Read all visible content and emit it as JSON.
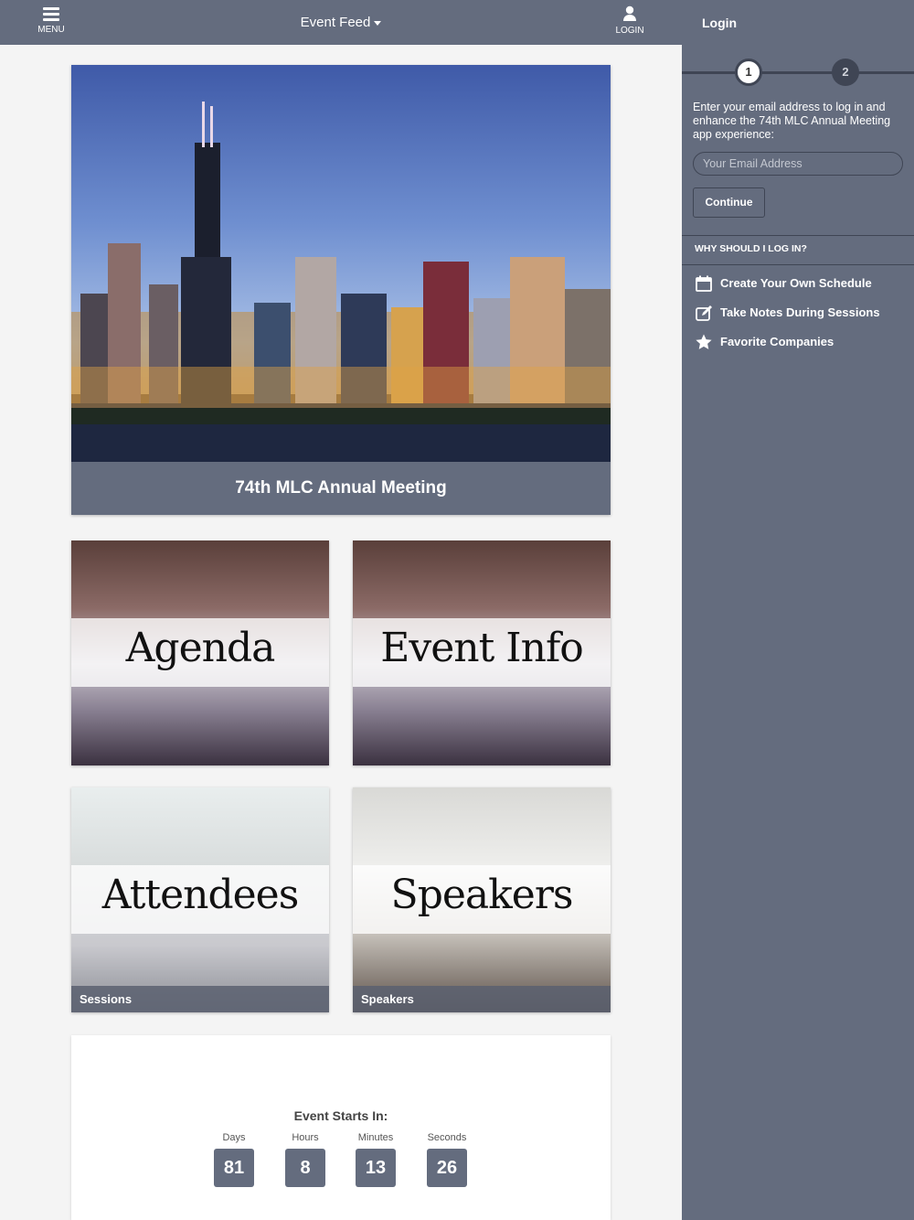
{
  "topbar": {
    "menu_label": "MENU",
    "title": "Event Feed",
    "login_label": "LOGIN"
  },
  "hero": {
    "caption": "74th MLC Annual Meeting"
  },
  "tiles": {
    "agenda": {
      "title": "Agenda",
      "footer": ""
    },
    "event_info": {
      "title": "Event Info",
      "footer": ""
    },
    "attendees": {
      "title": "Attendees",
      "footer": "Sessions"
    },
    "speakers": {
      "title": "Speakers",
      "footer": "Speakers"
    }
  },
  "countdown": {
    "heading": "Event Starts In:",
    "units": [
      {
        "label": "Days",
        "value": "81"
      },
      {
        "label": "Hours",
        "value": "8"
      },
      {
        "label": "Minutes",
        "value": "13"
      },
      {
        "label": "Seconds",
        "value": "26"
      }
    ]
  },
  "login_panel": {
    "title": "Login",
    "steps": [
      "1",
      "2"
    ],
    "intro": "Enter your email address to log in and enhance the 74th MLC Annual Meeting app experience:",
    "email_placeholder": "Your Email Address",
    "continue_label": "Continue",
    "why_heading": "WHY SHOULD I LOG IN?",
    "features": [
      {
        "icon": "calendar-icon",
        "label": "Create Your Own Schedule"
      },
      {
        "icon": "edit-note-icon",
        "label": "Take Notes During Sessions"
      },
      {
        "icon": "star-icon",
        "label": "Favorite Companies"
      }
    ]
  },
  "colors": {
    "bar": "#646c7e",
    "dark_accent": "#3f4554",
    "page_bg": "#f4f4f4"
  }
}
